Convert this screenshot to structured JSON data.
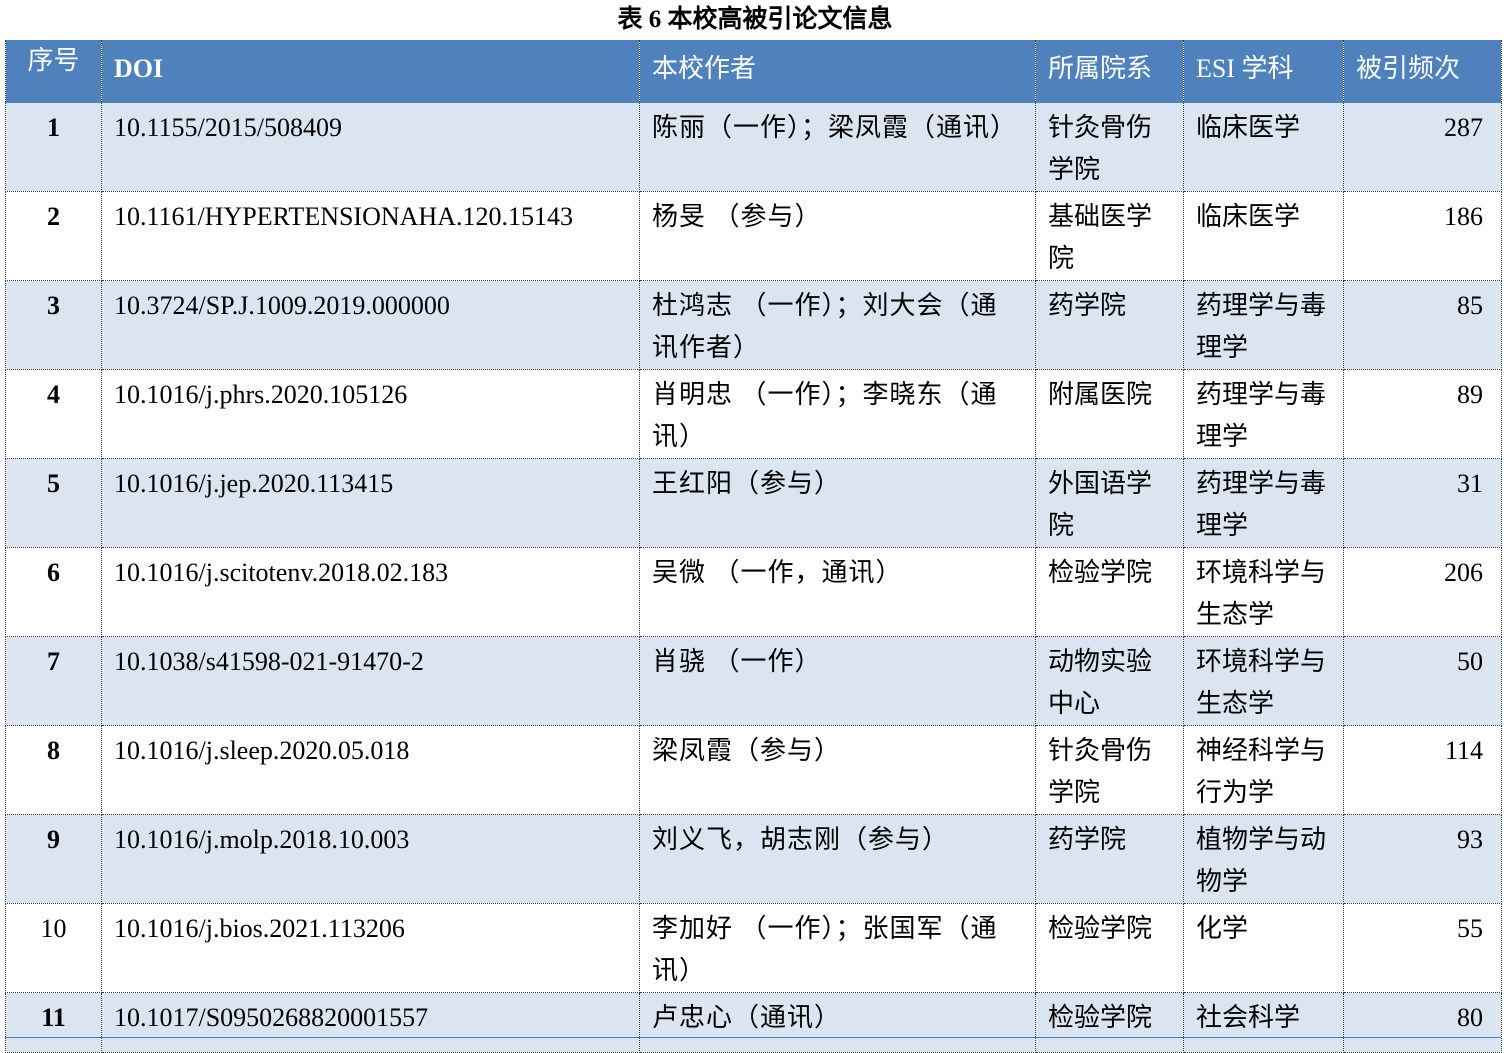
{
  "caption": "表 6  本校高被引论文信息",
  "headers": {
    "no": "序号",
    "doi": "DOI",
    "authors": "本校作者",
    "dept": "所属院系",
    "esi": "ESI 学科",
    "cites": "被引频次"
  },
  "rows": [
    {
      "no": "1",
      "doi": "10.1155/2015/508409",
      "authors": "陈丽（一作）；梁凤霞（通讯）",
      "dept": "针灸骨伤学院",
      "esi": "临床医学",
      "cites": "287"
    },
    {
      "no": "2",
      "doi": "10.1161/HYPERTENSIONAHA.120.15143",
      "authors": "杨旻 （参与）",
      "dept": "基础医学院",
      "esi": "临床医学",
      "cites": "186"
    },
    {
      "no": "3",
      "doi": "10.3724/SP.J.1009.2019.000000",
      "authors": "杜鸿志 （一作）；刘大会（通讯作者）",
      "dept": "药学院",
      "esi": "药理学与毒理学",
      "cites": "85"
    },
    {
      "no": "4",
      "doi": "10.1016/j.phrs.2020.105126",
      "authors": "肖明忠 （一作）；李晓东（通讯）",
      "dept": "附属医院",
      "esi": "药理学与毒理学",
      "cites": "89"
    },
    {
      "no": "5",
      "doi": "10.1016/j.jep.2020.113415",
      "authors": "王红阳（参与）",
      "dept": "外国语学院",
      "esi": "药理学与毒理学",
      "cites": "31"
    },
    {
      "no": "6",
      "doi": "10.1016/j.scitotenv.2018.02.183",
      "authors": "吴微 （一作，通讯）",
      "dept": "检验学院",
      "esi": "环境科学与生态学",
      "cites": "206"
    },
    {
      "no": "7",
      "doi": "10.1038/s41598-021-91470-2",
      "authors": "肖骁 （一作）",
      "dept": "动物实验中心",
      "esi": "环境科学与生态学",
      "cites": "50"
    },
    {
      "no": "8",
      "doi": "10.1016/j.sleep.2020.05.018",
      "authors": "梁凤霞（参与）",
      "dept": "针灸骨伤学院",
      "esi": "神经科学与行为学",
      "cites": "114"
    },
    {
      "no": "9",
      "doi": "10.1016/j.molp.2018.10.003",
      "authors": "刘义飞，胡志刚（参与）",
      "dept": "药学院",
      "esi": "植物学与动物学",
      "cites": "93"
    },
    {
      "no": "10",
      "doi": "10.1016/j.bios.2021.113206",
      "authors": "李加好 （一作）；张国军（通讯）",
      "dept": "检验学院",
      "esi": "化学",
      "cites": "55"
    },
    {
      "no": "11",
      "doi": "10.1017/S0950268820001557",
      "authors": "卢忠心（通讯）",
      "dept": "检验学院",
      "esi": "社会科学",
      "cites": "80"
    }
  ]
}
